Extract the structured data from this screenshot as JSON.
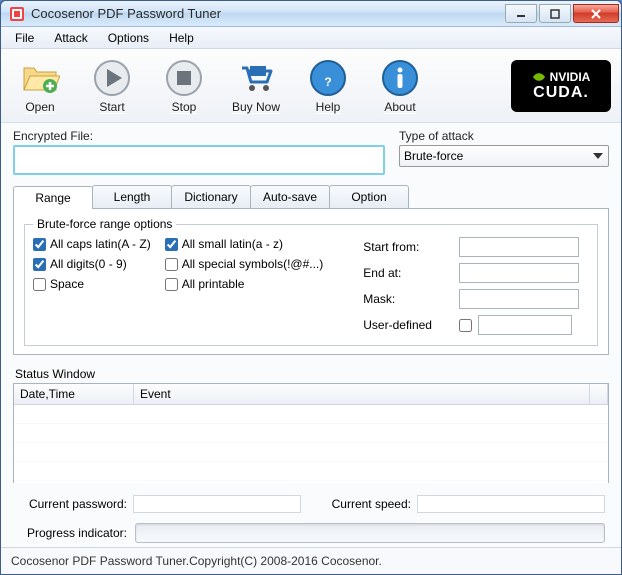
{
  "window": {
    "title": "Cocosenor PDF Password Tuner"
  },
  "menu": {
    "file": "File",
    "attack": "Attack",
    "options": "Options",
    "help": "Help"
  },
  "toolbar": {
    "open": "Open",
    "start": "Start",
    "stop": "Stop",
    "buynow": "Buy Now",
    "help": "Help",
    "about": "About",
    "cuda_brand": "NVIDIA",
    "cuda_text": "CUDA."
  },
  "fields": {
    "encrypted_file_label": "Encrypted File:",
    "encrypted_file_value": "",
    "attack_type_label": "Type of attack",
    "attack_type_value": "Brute-force"
  },
  "tabs": {
    "range": "Range",
    "length": "Length",
    "dictionary": "Dictionary",
    "autosave": "Auto-save",
    "option": "Option"
  },
  "bruteforce": {
    "legend": "Brute-force range options",
    "all_caps": "All caps latin(A - Z)",
    "all_caps_checked": true,
    "all_small": "All small latin(a - z)",
    "all_small_checked": true,
    "all_digits": "All digits(0 - 9)",
    "all_digits_checked": true,
    "all_special": "All special symbols(!@#...)",
    "all_special_checked": false,
    "space": "Space",
    "space_checked": false,
    "all_printable": "All printable",
    "all_printable_checked": false,
    "start_from_label": "Start from:",
    "start_from_value": "",
    "end_at_label": "End at:",
    "end_at_value": "",
    "mask_label": "Mask:",
    "mask_value": "",
    "user_defined_label": "User-defined",
    "user_defined_checked": false,
    "user_defined_value": ""
  },
  "status": {
    "title": "Status Window",
    "col_datetime": "Date,Time",
    "col_event": "Event"
  },
  "summary": {
    "current_password_label": "Current password:",
    "current_password_value": "",
    "current_speed_label": "Current speed:",
    "current_speed_value": "",
    "progress_label": "Progress indicator:"
  },
  "footer": "Cocosenor PDF Password Tuner.Copyright(C) 2008-2016 Cocosenor."
}
